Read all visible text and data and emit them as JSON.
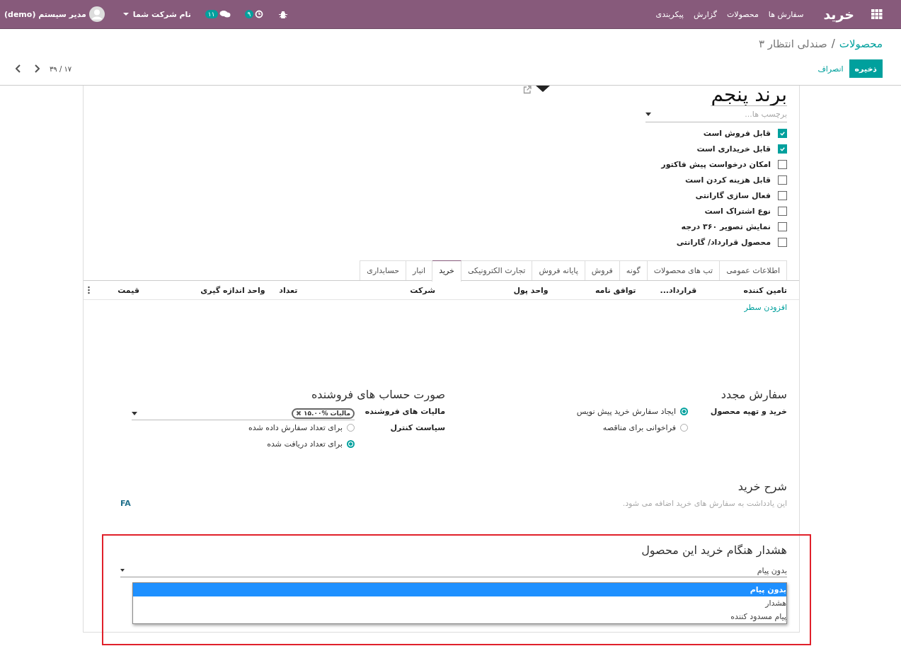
{
  "navbar": {
    "app_name": "خرید",
    "menus": [
      "سفارش ها",
      "محصولات",
      "گزارش",
      "پیکربندی"
    ],
    "activity_count": "۹",
    "message_count": "۱۱",
    "company": "نام شرکت شما",
    "user": "مدیر سیستم (demo)"
  },
  "breadcrumb": {
    "parent": "محصولات",
    "separator": "/",
    "current": "صندلی انتظار ۳"
  },
  "buttons": {
    "save": "ذخیره",
    "discard": "انصراف"
  },
  "pager": {
    "value": "۱۷ / ۳۹"
  },
  "product": {
    "name": "برند پنجم",
    "tags_placeholder": "برچسب ها...",
    "options": [
      {
        "label": "قابل فروش است",
        "checked": true
      },
      {
        "label": "قابل خریداری است",
        "checked": true
      },
      {
        "label": "امکان درخواست پیش فاکتور",
        "checked": false
      },
      {
        "label": "قابل هزینه کردن است",
        "checked": false
      },
      {
        "label": "فعال سازی گارانتی",
        "checked": false
      },
      {
        "label": "نوع اشتراک است",
        "checked": false
      },
      {
        "label": "نمایش تصویر ۳۶۰ درجه",
        "checked": false
      },
      {
        "label": "محصول قرارداد/ گارانتی",
        "checked": false
      }
    ]
  },
  "tabs": [
    {
      "label": "اطلاعات عمومی",
      "selected": false
    },
    {
      "label": "تب های محصولات",
      "selected": false
    },
    {
      "label": "گونه",
      "selected": false
    },
    {
      "label": "فروش",
      "selected": false
    },
    {
      "label": "پایانه فروش",
      "selected": false
    },
    {
      "label": "تجارت الکترونیکی",
      "selected": false
    },
    {
      "label": "خرید",
      "selected": true
    },
    {
      "label": "انبار",
      "selected": false
    },
    {
      "label": "حسابداری",
      "selected": false
    }
  ],
  "vendor_table": {
    "columns": [
      "تامین کننده",
      "قرارداد...",
      "توافق نامه",
      "واحد پول",
      "شرکت",
      "تعداد",
      "واحد اندازه گیری",
      "قیمت"
    ],
    "add_line": "افزودن سطر"
  },
  "reorder": {
    "title": "سفارش مجدد",
    "field_label": "خرید و تهیه محصول",
    "choices": [
      {
        "label": "ایجاد سفارش خرید پیش نویس",
        "selected": true
      },
      {
        "label": "فراخوانی برای مناقصه",
        "selected": false
      }
    ]
  },
  "vendor_bills": {
    "title": "صورت حساب های فروشنده",
    "taxes_label": "مالیات های فروشنده",
    "tax_tags": [
      "مالیات %۱۵.۰۰"
    ],
    "control_label": "سیاست کنترل",
    "control_choices": [
      {
        "label": "برای تعداد سفارش داده شده",
        "selected": false
      },
      {
        "label": "برای تعداد دریافت شده",
        "selected": true
      }
    ]
  },
  "purchase_description": {
    "title": "شرح خرید",
    "placeholder": "این یادداشت به سفارش های خرید اضافه می شود.",
    "lang_badge": "FA"
  },
  "warning": {
    "title": "هشدار هنگام خرید این محصول",
    "value": "بدون پیام",
    "options": [
      {
        "label": "بدون پیام",
        "selected": true
      },
      {
        "label": "هشدار",
        "selected": false
      },
      {
        "label": "پیام مسدود کننده",
        "selected": false
      }
    ]
  }
}
